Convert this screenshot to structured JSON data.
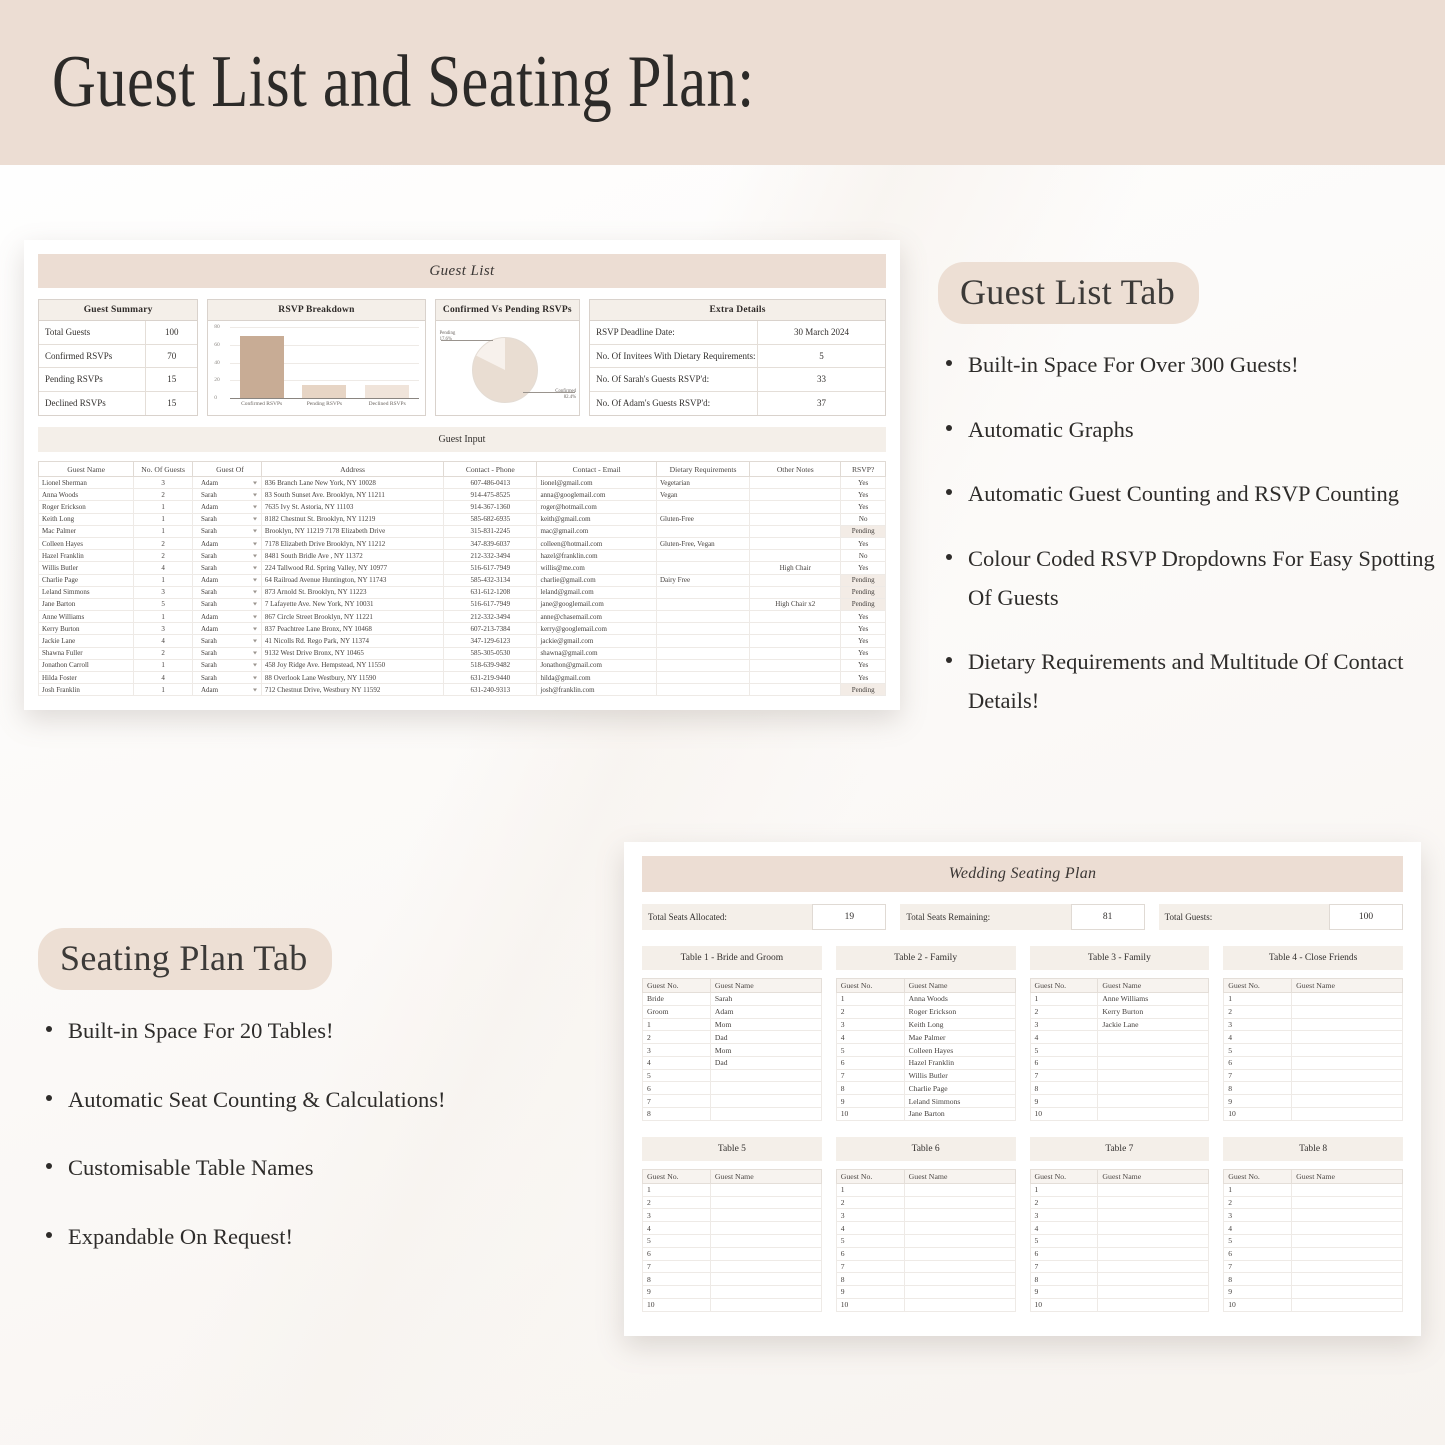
{
  "header": {
    "title": "Guest List and Seating Plan:"
  },
  "guest_list_screenshot": {
    "title": "Guest List",
    "guest_summary": {
      "heading": "Guest Summary",
      "rows": [
        {
          "label": "Total Guests",
          "value": "100"
        },
        {
          "label": "Confirmed RSVPs",
          "value": "70"
        },
        {
          "label": "Pending RSVPs",
          "value": "15"
        },
        {
          "label": "Declined RSVPs",
          "value": "15"
        }
      ]
    },
    "extra_details": {
      "heading": "Extra Details",
      "rows": [
        {
          "label": "RSVP Deadline Date:",
          "value": "30 March 2024"
        },
        {
          "label": "No. Of Invitees With Dietary Requirements:",
          "value": "5"
        },
        {
          "label": "No. Of Sarah's Guests RSVP'd:",
          "value": "33"
        },
        {
          "label": "No. Of Adam's Guests RSVP'd:",
          "value": "37"
        }
      ]
    },
    "guest_input_heading": "Guest Input",
    "table_headers": [
      "Guest Name",
      "No. Of Guests",
      "Guest Of",
      "Address",
      "Contact - Phone",
      "Contact - Email",
      "Dietary Requirements",
      "Other Notes",
      "RSVP?"
    ],
    "rows": [
      {
        "name": "Lionel Sherman",
        "num": "3",
        "of": "Adam",
        "address": "836 Branch Lane New York, NY 10028",
        "phone": "607-486-0413",
        "email": "lionel@gmail.com",
        "diet": "Vegetarian",
        "notes": "",
        "rsvp": "Yes"
      },
      {
        "name": "Anna Woods",
        "num": "2",
        "of": "Sarah",
        "address": "83 South Sunset Ave. Brooklyn, NY 11211",
        "phone": "914-475-8525",
        "email": "anna@googlemail.com",
        "diet": "Vegan",
        "notes": "",
        "rsvp": "Yes"
      },
      {
        "name": "Roger Erickson",
        "num": "1",
        "of": "Adam",
        "address": "7635 Ivy St. Astoria, NY 11103",
        "phone": "914-367-1360",
        "email": "roger@hotmail.com",
        "diet": "",
        "notes": "",
        "rsvp": "Yes"
      },
      {
        "name": "Keith Long",
        "num": "1",
        "of": "Sarah",
        "address": "8182 Chestnut St. Brooklyn, NY 11219",
        "phone": "585-682-6935",
        "email": "keith@gmail.com",
        "diet": "Gluten-Free",
        "notes": "",
        "rsvp": "No"
      },
      {
        "name": "Mac Palmer",
        "num": "1",
        "of": "Sarah",
        "address": "Brooklyn, NY 11219 7178 Elizabeth Drive",
        "phone": "315-831-2245",
        "email": "mac@gmail.com",
        "diet": "",
        "notes": "",
        "rsvp": "Pending"
      },
      {
        "name": "Colleen Hayes",
        "num": "2",
        "of": "Adam",
        "address": "7178 Elizabeth Drive Brooklyn, NY 11212",
        "phone": "347-839-6037",
        "email": "colleen@hotmail.com",
        "diet": "Gluten-Free, Vegan",
        "notes": "",
        "rsvp": "Yes"
      },
      {
        "name": "Hazel Franklin",
        "num": "2",
        "of": "Sarah",
        "address": "8481 South Bridle Ave , NY 11372",
        "phone": "212-332-3494",
        "email": "hazel@franklin.com",
        "diet": "",
        "notes": "",
        "rsvp": "No"
      },
      {
        "name": "Willis Butler",
        "num": "4",
        "of": "Sarah",
        "address": "224 Tallwood Rd. Spring Valley, NY 10977",
        "phone": "516-617-7949",
        "email": "willis@me.com",
        "diet": "",
        "notes": "High Chair",
        "rsvp": "Yes"
      },
      {
        "name": "Charlie Page",
        "num": "1",
        "of": "Adam",
        "address": "64 Railroad Avenue Huntington, NY 11743",
        "phone": "585-432-3134",
        "email": "charlie@gmail.com",
        "diet": "Dairy Free",
        "notes": "",
        "rsvp": "Pending"
      },
      {
        "name": "Leland Simmons",
        "num": "3",
        "of": "Sarah",
        "address": "873 Arnold St. Brooklyn, NY 11223",
        "phone": "631-612-1208",
        "email": "leland@gmail.com",
        "diet": "",
        "notes": "",
        "rsvp": "Pending"
      },
      {
        "name": "Jane Barton",
        "num": "5",
        "of": "Sarah",
        "address": "7 Lafayette Ave. New York, NY 10031",
        "phone": "516-617-7949",
        "email": "jane@googlemail.com",
        "diet": "",
        "notes": "High Chair x2",
        "rsvp": "Pending"
      },
      {
        "name": "Anne Williams",
        "num": "1",
        "of": "Adam",
        "address": "867 Circle Street Brooklyn, NY 11221",
        "phone": "212-332-3494",
        "email": "anne@chasemail.com",
        "diet": "",
        "notes": "",
        "rsvp": "Yes"
      },
      {
        "name": "Kerry Burton",
        "num": "3",
        "of": "Adam",
        "address": "837 Peachtree Lane Bronx, NY 10468",
        "phone": "607-213-7384",
        "email": "kerry@googlemail.com",
        "diet": "",
        "notes": "",
        "rsvp": "Yes"
      },
      {
        "name": "Jackie Lane",
        "num": "4",
        "of": "Sarah",
        "address": "41 Nicolls Rd. Rego Park, NY 11374",
        "phone": "347-129-6123",
        "email": "jackie@gmail.com",
        "diet": "",
        "notes": "",
        "rsvp": "Yes"
      },
      {
        "name": "Shawna Fuller",
        "num": "2",
        "of": "Sarah",
        "address": "9132 West Drive Bronx, NY 10465",
        "phone": "585-305-0530",
        "email": "shawna@gmail.com",
        "diet": "",
        "notes": "",
        "rsvp": "Yes"
      },
      {
        "name": "Jonathon Carroll",
        "num": "1",
        "of": "Sarah",
        "address": "458 Joy Ridge Ave. Hempstead, NY 11550",
        "phone": "518-639-9482",
        "email": "Jonathon@gmail.com",
        "diet": "",
        "notes": "",
        "rsvp": "Yes"
      },
      {
        "name": "Hilda Foster",
        "num": "4",
        "of": "Sarah",
        "address": "88 Overlook Lane Westbury, NY 11590",
        "phone": "631-219-9440",
        "email": "hilda@gmail.com",
        "diet": "",
        "notes": "",
        "rsvp": "Yes"
      },
      {
        "name": "Josh Franklin",
        "num": "1",
        "of": "Adam",
        "address": "712 Chestnut Drive, Westbury NY 11592",
        "phone": "631-240-9313",
        "email": "josh@franklin.com",
        "diet": "",
        "notes": "",
        "rsvp": "Pending"
      }
    ]
  },
  "chart_data": [
    {
      "type": "bar",
      "title": "RSVP Breakdown",
      "categories": [
        "Confirmed RSVPs",
        "Pending RSVPs",
        "Declined RSVPs"
      ],
      "values": [
        70,
        15,
        15
      ],
      "colors": [
        "#c8ac95",
        "#e7d5c5",
        "#f0e4da"
      ],
      "xlabel": "",
      "ylabel": "",
      "ylim": [
        0,
        80
      ],
      "yticks": [
        0,
        20,
        40,
        60,
        80
      ],
      "grid": true,
      "legend": "none"
    },
    {
      "type": "pie",
      "title": "Confirmed Vs Pending RSVPs",
      "labels": [
        "Confirmed",
        "Pending"
      ],
      "values": [
        82.4,
        17.6
      ],
      "value_labels": [
        "82.4%",
        "17.6%"
      ],
      "colors": [
        "#e9ddd2",
        "#f7f1ec"
      ],
      "legend": "callout-labels"
    }
  ],
  "guest_list_tab_panel": {
    "title": "Guest List Tab",
    "features": [
      "Built-in Space For Over 300 Guests!",
      "Automatic Graphs",
      "Automatic Guest Counting and RSVP Counting",
      "Colour Coded RSVP Dropdowns For Easy Spotting Of Guests",
      "Dietary Requirements and Multitude Of Contact Details!"
    ]
  },
  "seating_plan_tab_panel": {
    "title": "Seating Plan Tab",
    "features": [
      "Built-in Space For 20 Tables!",
      "Automatic Seat Counting & Calculations!",
      "Customisable Table Names",
      "Expandable On Request!"
    ]
  },
  "seating_plan_screenshot": {
    "title": "Wedding Seating Plan",
    "stats": [
      {
        "label": "Total Seats Allocated:",
        "value": "19"
      },
      {
        "label": "Total Seats Remaining:",
        "value": "81"
      },
      {
        "label": "Total Guests:",
        "value": "100"
      }
    ],
    "seat_headers": [
      "Guest No.",
      "Guest Name"
    ],
    "tables": [
      {
        "name": "Table 1 - Bride and Groom",
        "seats": [
          {
            "no": "Bride",
            "guest": "Sarah"
          },
          {
            "no": "Groom",
            "guest": "Adam"
          },
          {
            "no": "1",
            "guest": "Mom"
          },
          {
            "no": "2",
            "guest": "Dad"
          },
          {
            "no": "3",
            "guest": "Mom"
          },
          {
            "no": "4",
            "guest": "Dad"
          },
          {
            "no": "5",
            "guest": ""
          },
          {
            "no": "6",
            "guest": ""
          },
          {
            "no": "7",
            "guest": ""
          },
          {
            "no": "8",
            "guest": ""
          }
        ]
      },
      {
        "name": "Table 2 - Family",
        "seats": [
          {
            "no": "1",
            "guest": "Anna Woods"
          },
          {
            "no": "2",
            "guest": "Roger Erickson"
          },
          {
            "no": "3",
            "guest": "Keith Long"
          },
          {
            "no": "4",
            "guest": "Mae Palmer"
          },
          {
            "no": "5",
            "guest": "Colleen Hayes"
          },
          {
            "no": "6",
            "guest": "Hazel Franklin"
          },
          {
            "no": "7",
            "guest": "Willis Butler"
          },
          {
            "no": "8",
            "guest": "Charlie Page"
          },
          {
            "no": "9",
            "guest": "Leland Simmons"
          },
          {
            "no": "10",
            "guest": "Jane Barton"
          }
        ]
      },
      {
        "name": "Table 3 - Family",
        "seats": [
          {
            "no": "1",
            "guest": "Anne Williams"
          },
          {
            "no": "2",
            "guest": "Kerry Burton"
          },
          {
            "no": "3",
            "guest": "Jackie Lane"
          },
          {
            "no": "4",
            "guest": ""
          },
          {
            "no": "5",
            "guest": ""
          },
          {
            "no": "6",
            "guest": ""
          },
          {
            "no": "7",
            "guest": ""
          },
          {
            "no": "8",
            "guest": ""
          },
          {
            "no": "9",
            "guest": ""
          },
          {
            "no": "10",
            "guest": ""
          }
        ]
      },
      {
        "name": "Table 4 - Close Friends",
        "seats": [
          {
            "no": "1",
            "guest": ""
          },
          {
            "no": "2",
            "guest": ""
          },
          {
            "no": "3",
            "guest": ""
          },
          {
            "no": "4",
            "guest": ""
          },
          {
            "no": "5",
            "guest": ""
          },
          {
            "no": "6",
            "guest": ""
          },
          {
            "no": "7",
            "guest": ""
          },
          {
            "no": "8",
            "guest": ""
          },
          {
            "no": "9",
            "guest": ""
          },
          {
            "no": "10",
            "guest": ""
          }
        ]
      },
      {
        "name": "Table 5",
        "seats": [
          {
            "no": "1",
            "guest": ""
          },
          {
            "no": "2",
            "guest": ""
          },
          {
            "no": "3",
            "guest": ""
          },
          {
            "no": "4",
            "guest": ""
          },
          {
            "no": "5",
            "guest": ""
          },
          {
            "no": "6",
            "guest": ""
          },
          {
            "no": "7",
            "guest": ""
          },
          {
            "no": "8",
            "guest": ""
          },
          {
            "no": "9",
            "guest": ""
          },
          {
            "no": "10",
            "guest": ""
          }
        ]
      },
      {
        "name": "Table 6",
        "seats": [
          {
            "no": "1",
            "guest": ""
          },
          {
            "no": "2",
            "guest": ""
          },
          {
            "no": "3",
            "guest": ""
          },
          {
            "no": "4",
            "guest": ""
          },
          {
            "no": "5",
            "guest": ""
          },
          {
            "no": "6",
            "guest": ""
          },
          {
            "no": "7",
            "guest": ""
          },
          {
            "no": "8",
            "guest": ""
          },
          {
            "no": "9",
            "guest": ""
          },
          {
            "no": "10",
            "guest": ""
          }
        ]
      },
      {
        "name": "Table 7",
        "seats": [
          {
            "no": "1",
            "guest": ""
          },
          {
            "no": "2",
            "guest": ""
          },
          {
            "no": "3",
            "guest": ""
          },
          {
            "no": "4",
            "guest": ""
          },
          {
            "no": "5",
            "guest": ""
          },
          {
            "no": "6",
            "guest": ""
          },
          {
            "no": "7",
            "guest": ""
          },
          {
            "no": "8",
            "guest": ""
          },
          {
            "no": "9",
            "guest": ""
          },
          {
            "no": "10",
            "guest": ""
          }
        ]
      },
      {
        "name": "Table 8",
        "seats": [
          {
            "no": "1",
            "guest": ""
          },
          {
            "no": "2",
            "guest": ""
          },
          {
            "no": "3",
            "guest": ""
          },
          {
            "no": "4",
            "guest": ""
          },
          {
            "no": "5",
            "guest": ""
          },
          {
            "no": "6",
            "guest": ""
          },
          {
            "no": "7",
            "guest": ""
          },
          {
            "no": "8",
            "guest": ""
          },
          {
            "no": "9",
            "guest": ""
          },
          {
            "no": "10",
            "guest": ""
          }
        ]
      }
    ]
  },
  "theme": {
    "banner_bg": "#ecddd3",
    "pill_bg": "#eddfd4",
    "header_row_bg": "#f4efe9",
    "bar_primary": "#c8ac95",
    "pending_bg": "#f3ece6"
  }
}
